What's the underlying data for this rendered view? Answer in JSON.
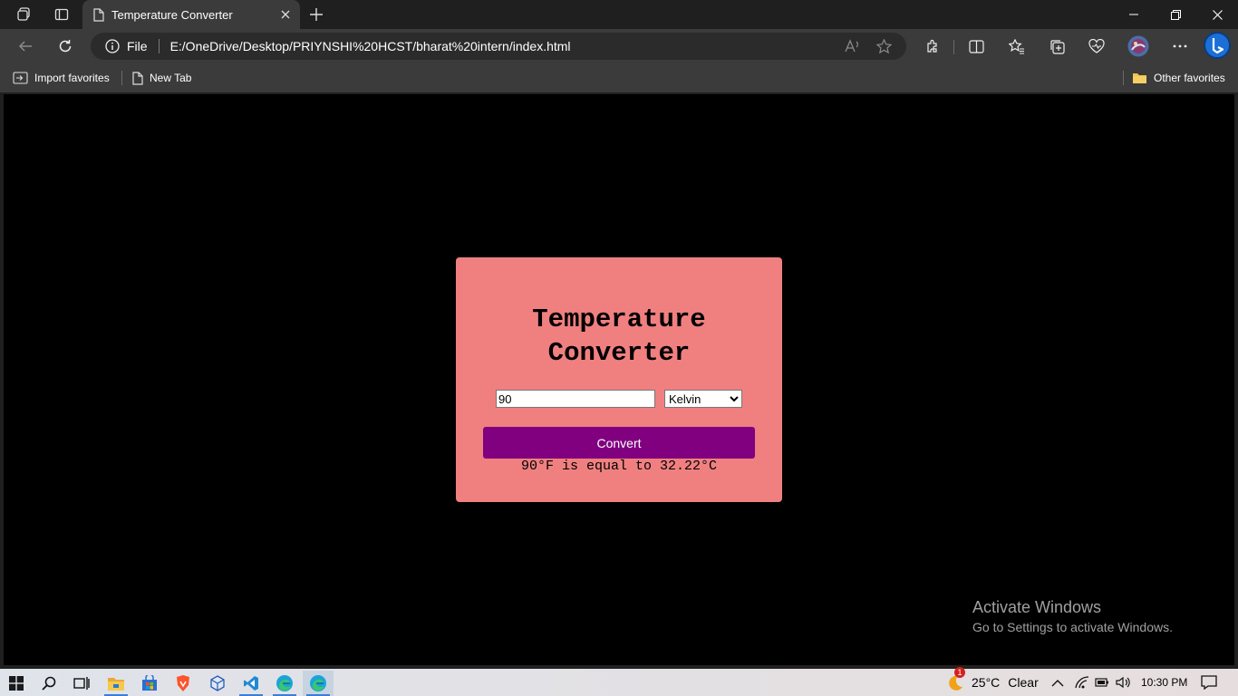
{
  "browser": {
    "tab": {
      "title": "Temperature Converter"
    },
    "address": {
      "scheme": "File",
      "url": "E:/OneDrive/Desktop/PRIYNSHI%20HCST/bharat%20intern/index.html"
    },
    "favorites": [
      {
        "label": "Import favorites",
        "icon": "import-icon"
      },
      {
        "label": "New Tab",
        "icon": "page-icon"
      }
    ],
    "other_favorites": "Other favorites"
  },
  "page": {
    "heading_line1": "Temperature",
    "heading_line2": "Converter",
    "input_value": "90",
    "unit_selected": "Kelvin",
    "convert_label": "Convert",
    "result": "90°F is equal to 32.22°C",
    "colors": {
      "card": "#f08080",
      "button": "#800080",
      "background": "#000000"
    }
  },
  "watermark": {
    "title": "Activate Windows",
    "subtitle": "Go to Settings to activate Windows."
  },
  "taskbar": {
    "weather_temp": "25°C",
    "weather_desc": "Clear",
    "weather_badge": "1",
    "time": "10:30 PM"
  }
}
